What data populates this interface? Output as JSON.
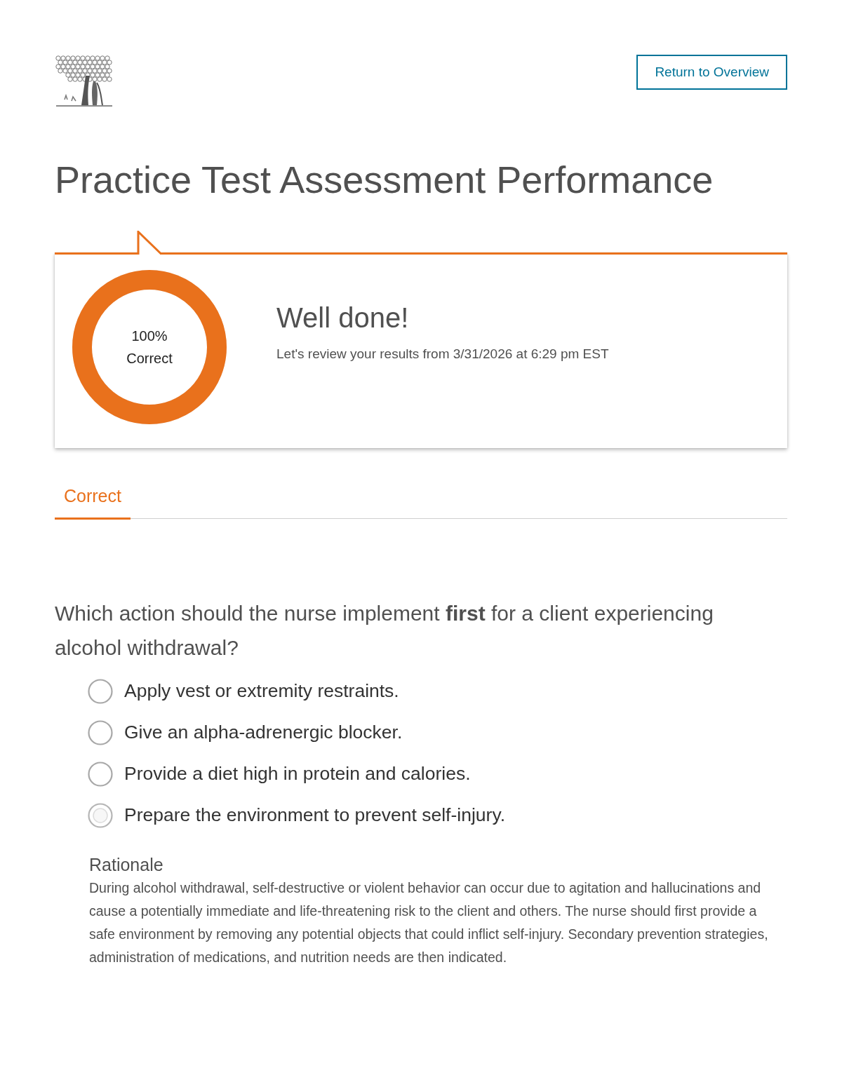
{
  "header": {
    "return_button": "Return to Overview"
  },
  "title": "Practice Test Assessment Performance",
  "results": {
    "score": {
      "percent": "100%",
      "label": "Correct",
      "level": 1
    },
    "heading": "Well done!",
    "subtitle": "Let's review your results from 3/31/2026 at 6:29 pm EST"
  },
  "tabs": [
    {
      "label": "Correct",
      "selected": true
    }
  ],
  "question": {
    "text": "Which action should the nurse implement **first** for a client experiencing alcohol withdrawal?",
    "options": [
      {
        "text": "Apply vest or extremity restraints.",
        "selected": false
      },
      {
        "text": "Give an alpha-adrenergic blocker.",
        "selected": false
      },
      {
        "text": "Provide a diet high in protein and calories.",
        "selected": false
      },
      {
        "text": "Prepare the environment to prevent self-injury.",
        "selected": true
      }
    ]
  },
  "rationale": {
    "heading": "Rationale",
    "text": "During alcohol withdrawal, self-destructive or violent behavior can occur due to agitation and hallucinations and cause a potentially immediate and life-threatening risk to the client and others. The nurse should first provide a safe environment by removing any potential objects that could inflict self-injury. Secondary prevention strategies, administration of medications, and nutrition needs are then indicated."
  }
}
